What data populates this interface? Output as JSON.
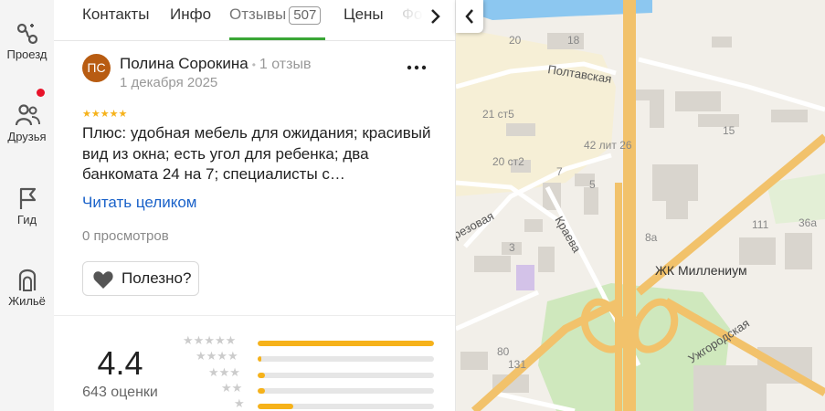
{
  "rail": {
    "items": [
      {
        "label": "Проезд",
        "icon": "route-icon"
      },
      {
        "label": "Друзья",
        "icon": "friends-icon"
      },
      {
        "label": "Гид",
        "icon": "flag-icon"
      },
      {
        "label": "Жильё",
        "icon": "housing-icon"
      }
    ]
  },
  "tabs": [
    {
      "label": "Контакты"
    },
    {
      "label": "Инфо"
    },
    {
      "label": "Отзывы",
      "count": "507"
    },
    {
      "label": "Цены"
    },
    {
      "label": "Фо"
    }
  ],
  "review": {
    "avatar_initials": "ПС",
    "author": "Полина Сорокина",
    "author_meta": "1 отзыв",
    "date": "1 декабря 2025",
    "stars": "★★★★★",
    "text": "Плюс: удобная мебель для ожидания; красивый вид из окна; есть угол для ребенка; два банкомата 24 на 7; специалисты с…",
    "read_more": "Читать целиком",
    "views": "0 просмотров",
    "useful_label": "Полезно?"
  },
  "summary": {
    "rating": "4.4",
    "count_label": "643 оценки",
    "distribution": [
      {
        "stars": "★★★★★",
        "fraction": 1.0
      },
      {
        "stars": "★★★★",
        "fraction": 0.02
      },
      {
        "stars": "★★★",
        "fraction": 0.04
      },
      {
        "stars": "★★",
        "fraction": 0.04
      },
      {
        "stars": "★",
        "fraction": 0.2
      }
    ]
  },
  "map": {
    "labels": {
      "n20": "20",
      "n18": "18",
      "poltavskaya": "Полтавская",
      "n15": "15",
      "n21st5": "21 ст5",
      "n42lit26": "42 лит 26",
      "n20st2": "20 ст2",
      "n7": "7",
      "n5": "5",
      "berezovaya": "резовая",
      "kraeva": "Краева",
      "n8a": "8а",
      "n111": "111",
      "n36a": "36а",
      "n3": "3",
      "millenium": "ЖК Миллениум",
      "uzhgorodskaya": "Ужгородская",
      "n80": "80",
      "n131": "131"
    }
  },
  "colors": {
    "accent_green": "#3aa636",
    "star_yellow": "#f6b21a",
    "link_blue": "#1a62c9",
    "avatar_brown": "#b85c12",
    "notification_red": "#e8132a"
  }
}
